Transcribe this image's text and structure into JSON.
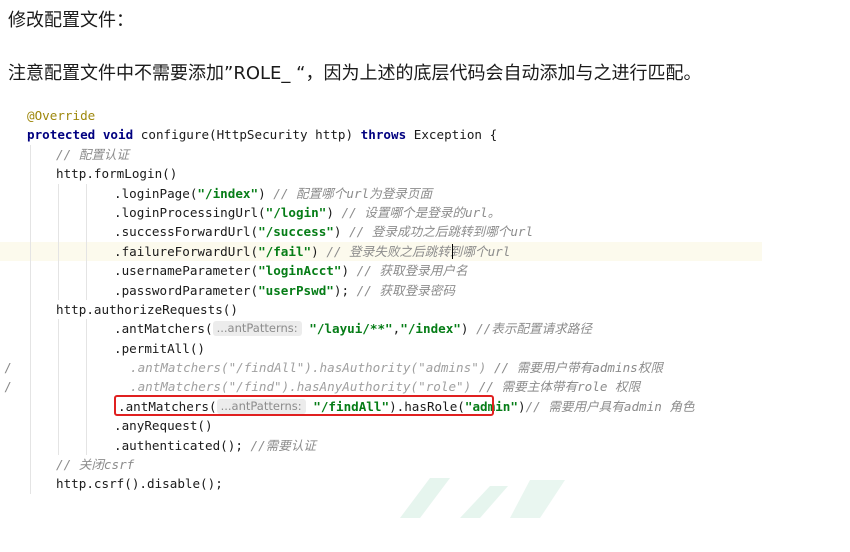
{
  "heading1": "修改配置文件：",
  "heading2": "注意配置文件中不需要添加”ROLE_ “，因为上述的底层代码会自动添加与之进行匹配。",
  "gutter_mark": "/",
  "code": {
    "l1": {
      "annotation": "@Override"
    },
    "l2": {
      "kw_protected": "protected",
      "kw_void": "void",
      "sig": "configure(HttpSecurity http) ",
      "kw_throws": "throws",
      "rest": "Exception {"
    },
    "l3": {
      "comment": "// 配置认证"
    },
    "l4": {
      "code": "http.formLogin()"
    },
    "l5": {
      "code": ".loginPage(",
      "str": "\"/index\"",
      "close": ") ",
      "comment": "// 配置哪个url为登录页面"
    },
    "l6": {
      "code": ".loginProcessingUrl(",
      "str": "\"/login\"",
      "close": ") ",
      "comment": "// 设置哪个是登录的url。"
    },
    "l7": {
      "code": ".successForwardUrl(",
      "str": "\"/success\"",
      "close": ") ",
      "comment": "// 登录成功之后跳转到哪个url"
    },
    "l8": {
      "code": ".failureForwardUrl(",
      "str": "\"/fail\"",
      "close": ") ",
      "comment": "// 登录失败之后跳转到哪个url"
    },
    "l9": {
      "code": ".usernameParameter(",
      "str": "\"loginAcct\"",
      "close": ") ",
      "comment": "// 获取登录用户名"
    },
    "l10": {
      "code": ".passwordParameter(",
      "str": "\"userPswd\"",
      "close": "); ",
      "comment": "// 获取登录密码"
    },
    "l11": {
      "code": "http.authorizeRequests()"
    },
    "l12": {
      "code": ".antMatchers(",
      "hint": "...antPatterns:",
      "str1": "\"/layui/**\"",
      "comma": ",",
      "str2": "\"/index\"",
      "close": ") ",
      "comment": "//表示配置请求路径"
    },
    "l13": {
      "code": ".permitAll()"
    },
    "l14": {
      "dim": ".antMatchers(\"/findAll\").hasAuthority(\"admins\") ",
      "comment": "// 需要用户带有admins权限"
    },
    "l15": {
      "dim": ".antMatchers(\"/find\").hasAnyAuthority(\"role\") ",
      "comment": "// 需要主体带有role 权限"
    },
    "l16": {
      "code": ".antMatchers(",
      "hint": "...antPatterns:",
      "str1": "\"/findAll\"",
      "mid": ").hasRole(",
      "str2": "\"admin\"",
      "close": ")",
      "comment": "// 需要用户具有admin 角色"
    },
    "l17": {
      "code": ".anyRequest()"
    },
    "l18": {
      "code": ".authenticated(); ",
      "comment": "//需要认证"
    },
    "l19": {
      "comment": "// 关闭csrf"
    },
    "l20": {
      "code": "http.csrf().disable();"
    }
  },
  "colors": {
    "keyword": "#000080",
    "string": "#067d17",
    "comment": "#8c8c8c",
    "annotation": "#9e880d",
    "highlight_box": "#e02020",
    "current_line": "#fcfaed"
  }
}
